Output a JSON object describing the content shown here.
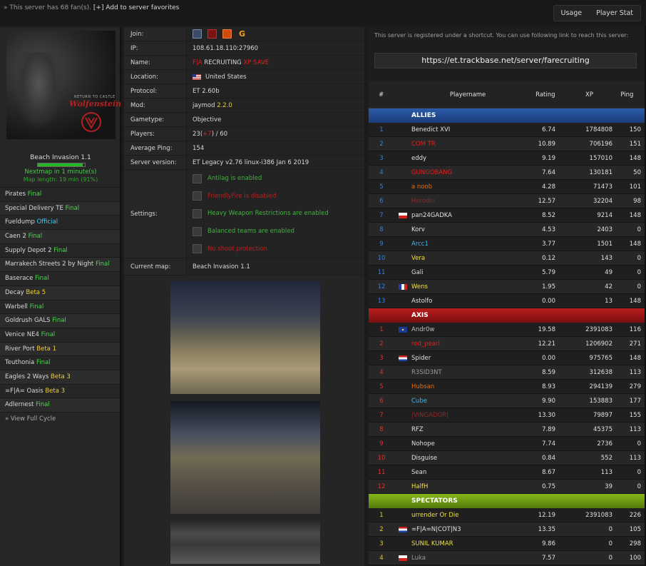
{
  "topbar": {
    "fans_text": "» This server has 68 fan(s).",
    "fav_text": "[+] Add to server favorites",
    "tabs": [
      "Usage",
      "Player Stat"
    ]
  },
  "left": {
    "map_title": "Beach Invasion 1.1",
    "progress_fraction": 0.95,
    "nextmap": "Nextmap in 1 minute(s)",
    "map_length": "Map length: 19 min (91%)",
    "logo_small": "RETURN TO CASTLE",
    "logo_big": "Wolfenstein",
    "cycle": [
      {
        "name": "Pirates",
        "status": "Final",
        "type": "final"
      },
      {
        "name": "Special Delivery TE",
        "status": "Final",
        "type": "final"
      },
      {
        "name": "Fueldump",
        "status": "Official",
        "type": "official"
      },
      {
        "name": "Caen 2",
        "status": "Final",
        "type": "final"
      },
      {
        "name": "Supply Depot 2",
        "status": "Final",
        "type": "final"
      },
      {
        "name": "Marrakech Streets 2 by Night",
        "status": "Final",
        "type": "final"
      },
      {
        "name": "Baserace",
        "status": "Final",
        "type": "final"
      },
      {
        "name": "Decay",
        "status": "Beta 5",
        "type": "beta"
      },
      {
        "name": "Warbell",
        "status": "Final",
        "type": "final"
      },
      {
        "name": "Goldrush GALS",
        "status": "Final",
        "type": "final"
      },
      {
        "name": "Venice NE4",
        "status": "Final",
        "type": "final"
      },
      {
        "name": "River Port",
        "status": "Beta 1",
        "type": "beta"
      },
      {
        "name": "Teuthonia",
        "status": "Final",
        "type": "final"
      },
      {
        "name": "Eagles 2 Ways",
        "status": "Beta 3",
        "type": "beta"
      },
      {
        "name": "=F|A= Oasis",
        "status": "Beta 3",
        "type": "beta"
      },
      {
        "name": "Adlernest",
        "status": "Final",
        "type": "final"
      }
    ],
    "view_cycle": "» View Full Cycle"
  },
  "info": {
    "join_label": "Join:",
    "ip_label": "IP:",
    "ip": "108.61.18.110:27960",
    "name_label": "Name:",
    "name_prefix": "F|A",
    "name_middle": " RECRUITING ",
    "name_suffix": "XP SAVE",
    "location_label": "Location:",
    "location": "United States",
    "protocol_label": "Protocol:",
    "protocol": "ET 2.60b",
    "mod_label": "Mod:",
    "mod_name": "jaymod",
    "mod_version": "2.2.0",
    "gametype_label": "Gametype:",
    "gametype": "Objective",
    "players_label": "Players:",
    "players_cur": "23",
    "players_extra": "+7",
    "players_max": "60",
    "ping_label": "Average Ping:",
    "ping": "154",
    "version_label": "Server version:",
    "version": "ET Legacy v2.76 linux-i386 Jan 6 2019",
    "settings_label": "Settings:",
    "settings": [
      {
        "text": "Antilag is enabled",
        "state": "on"
      },
      {
        "text": "FriendlyFire is disabled",
        "state": "off"
      },
      {
        "text": "Heavy Weapon Restrictions are enabled",
        "state": "on"
      },
      {
        "text": "Balanced teams are enabled",
        "state": "on"
      },
      {
        "text": "No shoot protection",
        "state": "off"
      }
    ],
    "currentmap_label": "Current map:",
    "currentmap": "Beach Invasion 1.1"
  },
  "right": {
    "note": "This server is registered under a shortcut. You can use following link to reach this server:",
    "url": "https://et.trackbase.net/server/farecruiting",
    "headers": {
      "num": "#",
      "name": "Playername",
      "rating": "Rating",
      "xp": "XP",
      "ping": "Ping"
    },
    "teams": {
      "allies": "ALLIES",
      "axis": "AXIS",
      "spec": "SPECTATORS"
    },
    "allies": [
      {
        "n": "1",
        "flag": "",
        "name": "Benedict XVI",
        "color": "#e0e0e0",
        "rating": "6.74",
        "xp": "1784808",
        "ping": "150"
      },
      {
        "n": "2",
        "flag": "",
        "name": "COM TR",
        "color": "#e02020",
        "rating": "10.89",
        "xp": "706196",
        "ping": "151"
      },
      {
        "n": "3",
        "flag": "",
        "name": "eddy",
        "color": "#e0e0e0",
        "rating": "9.19",
        "xp": "157010",
        "ping": "148"
      },
      {
        "n": "4",
        "flag": "",
        "name": "GUNGOBANG",
        "color": "#e02020",
        "rating": "7.64",
        "xp": "130181",
        "ping": "50"
      },
      {
        "n": "5",
        "flag": "",
        "name": "a noob",
        "color": "#e07010",
        "rating": "4.28",
        "xp": "71473",
        "ping": "101"
      },
      {
        "n": "6",
        "flag": "",
        "name": "Herodin",
        "color": "#8a2a2a",
        "rating": "12.57",
        "xp": "32204",
        "ping": "98"
      },
      {
        "n": "7",
        "flag": "pl",
        "name": "pan24GADKA",
        "color": "#e0e0e0",
        "rating": "8.52",
        "xp": "9214",
        "ping": "148"
      },
      {
        "n": "8",
        "flag": "",
        "name": "Korv",
        "color": "#e0e0e0",
        "rating": "4.53",
        "xp": "2403",
        "ping": "0"
      },
      {
        "n": "9",
        "flag": "",
        "name": "Arcc1",
        "color": "#3fb8f0",
        "rating": "3.77",
        "xp": "1501",
        "ping": "148"
      },
      {
        "n": "10",
        "flag": "",
        "name": "Vera",
        "color": "#f0e040",
        "rating": "0.12",
        "xp": "143",
        "ping": "0"
      },
      {
        "n": "11",
        "flag": "",
        "name": "Gali",
        "color": "#e0e0e0",
        "rating": "5.79",
        "xp": "49",
        "ping": "0"
      },
      {
        "n": "12",
        "flag": "fr",
        "name": "Wens",
        "color": "#f0e040",
        "rating": "1.95",
        "xp": "42",
        "ping": "0"
      },
      {
        "n": "13",
        "flag": "",
        "name": "Astolfo",
        "color": "#e0e0e0",
        "rating": "0.00",
        "xp": "13",
        "ping": "148"
      }
    ],
    "axis": [
      {
        "n": "1",
        "flag": "eu",
        "name": "Andr0w",
        "color": "#bcbcbc",
        "rating": "19.58",
        "xp": "2391083",
        "ping": "116"
      },
      {
        "n": "2",
        "flag": "",
        "name": "red_pearl",
        "color": "#e02020",
        "rating": "12.21",
        "xp": "1206902",
        "ping": "271"
      },
      {
        "n": "3",
        "flag": "nl",
        "name": "Spider",
        "color": "#e0e0e0",
        "rating": "0.00",
        "xp": "975765",
        "ping": "148"
      },
      {
        "n": "4",
        "flag": "",
        "name": "R3SID3NT",
        "color": "#9a9a9a",
        "rating": "8.59",
        "xp": "312638",
        "ping": "113"
      },
      {
        "n": "5",
        "flag": "",
        "name": "Hubsan",
        "color": "#e07010",
        "rating": "8.93",
        "xp": "294139",
        "ping": "279"
      },
      {
        "n": "6",
        "flag": "",
        "name": "Cube",
        "color": "#3fb8f0",
        "rating": "9.90",
        "xp": "153883",
        "ping": "177"
      },
      {
        "n": "7",
        "flag": "",
        "name": "|VINGADOR|",
        "color": "#8a2a2a",
        "rating": "13.30",
        "xp": "79897",
        "ping": "155"
      },
      {
        "n": "8",
        "flag": "",
        "name": "RFZ",
        "color": "#e0e0e0",
        "rating": "7.89",
        "xp": "45375",
        "ping": "113"
      },
      {
        "n": "9",
        "flag": "",
        "name": "Nohope",
        "color": "#e0e0e0",
        "rating": "7.74",
        "xp": "2736",
        "ping": "0"
      },
      {
        "n": "10",
        "flag": "",
        "name": "Disguise",
        "color": "#e0e0e0",
        "rating": "0.84",
        "xp": "552",
        "ping": "113"
      },
      {
        "n": "11",
        "flag": "",
        "name": "Sean",
        "color": "#e0e0e0",
        "rating": "8.67",
        "xp": "113",
        "ping": "0"
      },
      {
        "n": "12",
        "flag": "",
        "name": "HalfH",
        "color": "#f0e040",
        "rating": "0.75",
        "xp": "39",
        "ping": "0"
      }
    ],
    "spec": [
      {
        "n": "1",
        "flag": "",
        "name": "urrender Or Die",
        "color": "#f0e040",
        "rating": "12.19",
        "xp": "2391083",
        "ping": "226"
      },
      {
        "n": "2",
        "flag": "nl",
        "name": "=F|A=N|COT|N3",
        "color": "#e0e0e0",
        "rating": "13.35",
        "xp": "0",
        "ping": "105"
      },
      {
        "n": "3",
        "flag": "",
        "name": "SUNIL KUMAR",
        "color": "#f0e040",
        "rating": "9.86",
        "xp": "0",
        "ping": "298"
      },
      {
        "n": "4",
        "flag": "pl",
        "name": "Luka",
        "color": "#9a9a9a",
        "rating": "7.57",
        "xp": "0",
        "ping": "100"
      }
    ]
  }
}
